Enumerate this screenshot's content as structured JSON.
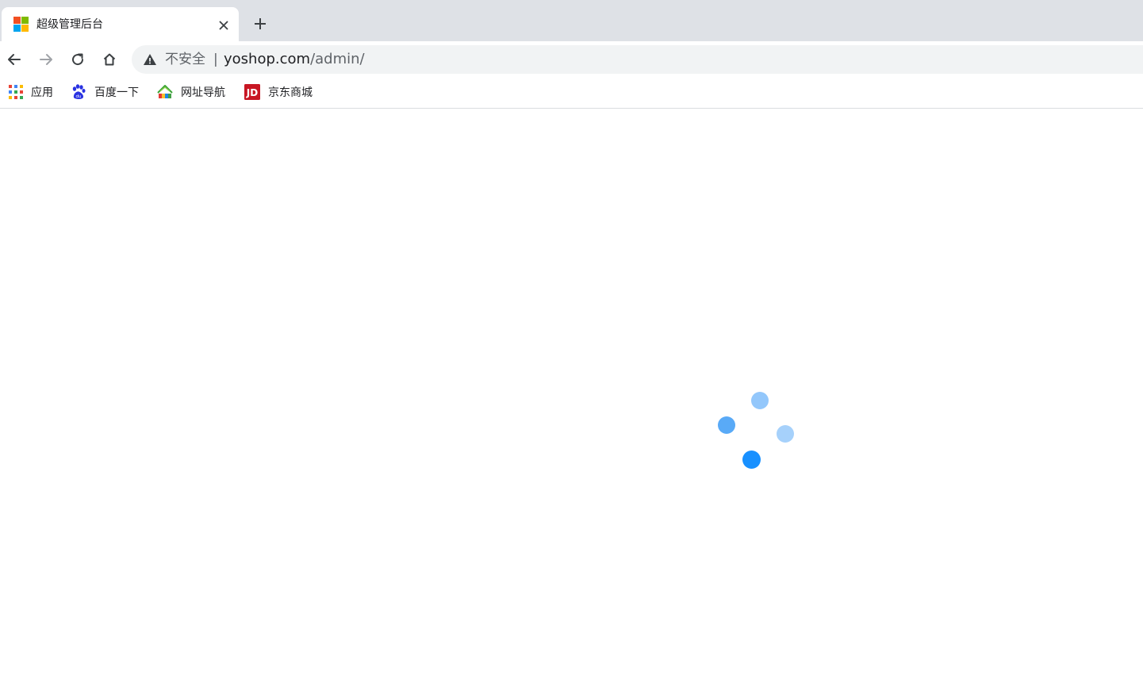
{
  "tab": {
    "title": "超级管理后台",
    "close_symbol": "✕",
    "favicon": "windows-logo-icon",
    "favicon_colors": [
      "#f25022",
      "#7fba00",
      "#00a4ef",
      "#ffb900"
    ]
  },
  "new_tab_symbol": "+",
  "toolbar": {
    "back_icon": "arrow-left-icon",
    "forward_icon": "arrow-right-icon",
    "reload_icon": "reload-icon",
    "home_icon": "home-icon"
  },
  "omnibox": {
    "security_label": "不安全",
    "separator": "|",
    "url_host": "yoshop.com",
    "url_path": "/admin/"
  },
  "bookmarks": [
    {
      "label": "应用",
      "icon": "apps-grid-icon"
    },
    {
      "label": "百度一下",
      "icon": "baidu-paw-icon"
    },
    {
      "label": "网址导航",
      "icon": "2345-house-icon"
    },
    {
      "label": "京东商城",
      "icon": "jd-logo-icon"
    }
  ],
  "colors": {
    "tabstrip_bg": "#dee1e6",
    "omnibox_bg": "#f1f3f4",
    "loader_dark": "#1890ff",
    "loader_mid": "#59aaf7",
    "loader_light": "#93c7fb"
  }
}
